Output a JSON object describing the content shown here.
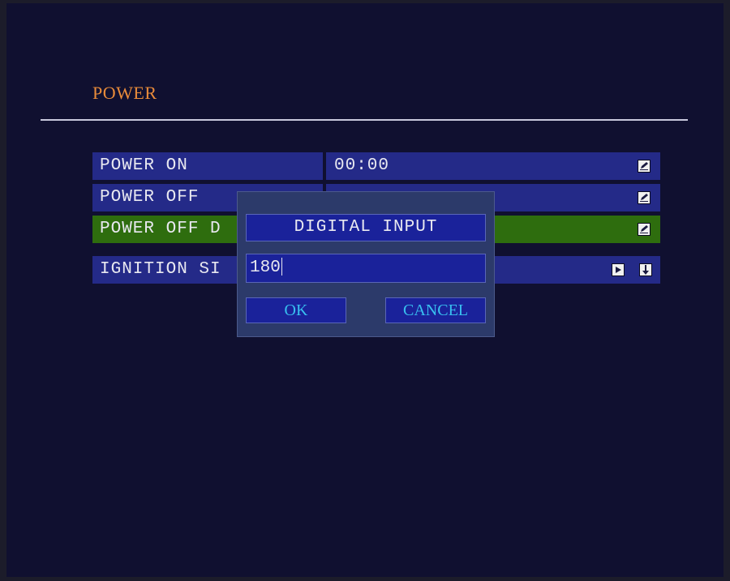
{
  "page": {
    "title": "POWER"
  },
  "rows": [
    {
      "label": "POWER ON",
      "value": "00:00",
      "icons": [
        "edit-icon"
      ],
      "selected": false
    },
    {
      "label": "POWER OFF",
      "value": "",
      "icons": [
        "edit-icon"
      ],
      "selected": false
    },
    {
      "label": "POWER OFF D",
      "value": "",
      "icons": [
        "edit-icon"
      ],
      "selected": true
    },
    {
      "label": "IGNITION SI",
      "value": "",
      "icons": [
        "play-icon",
        "down-arrow-icon"
      ],
      "selected": false
    }
  ],
  "dialog": {
    "title": "DIGITAL INPUT",
    "input_value": "180",
    "ok_label": "OK",
    "cancel_label": "CANCEL"
  },
  "colors": {
    "background": "#101030",
    "row": "#242a88",
    "row_selected": "#2e6d0e",
    "title": "#e98b3a",
    "button_text": "#38c0f0"
  }
}
